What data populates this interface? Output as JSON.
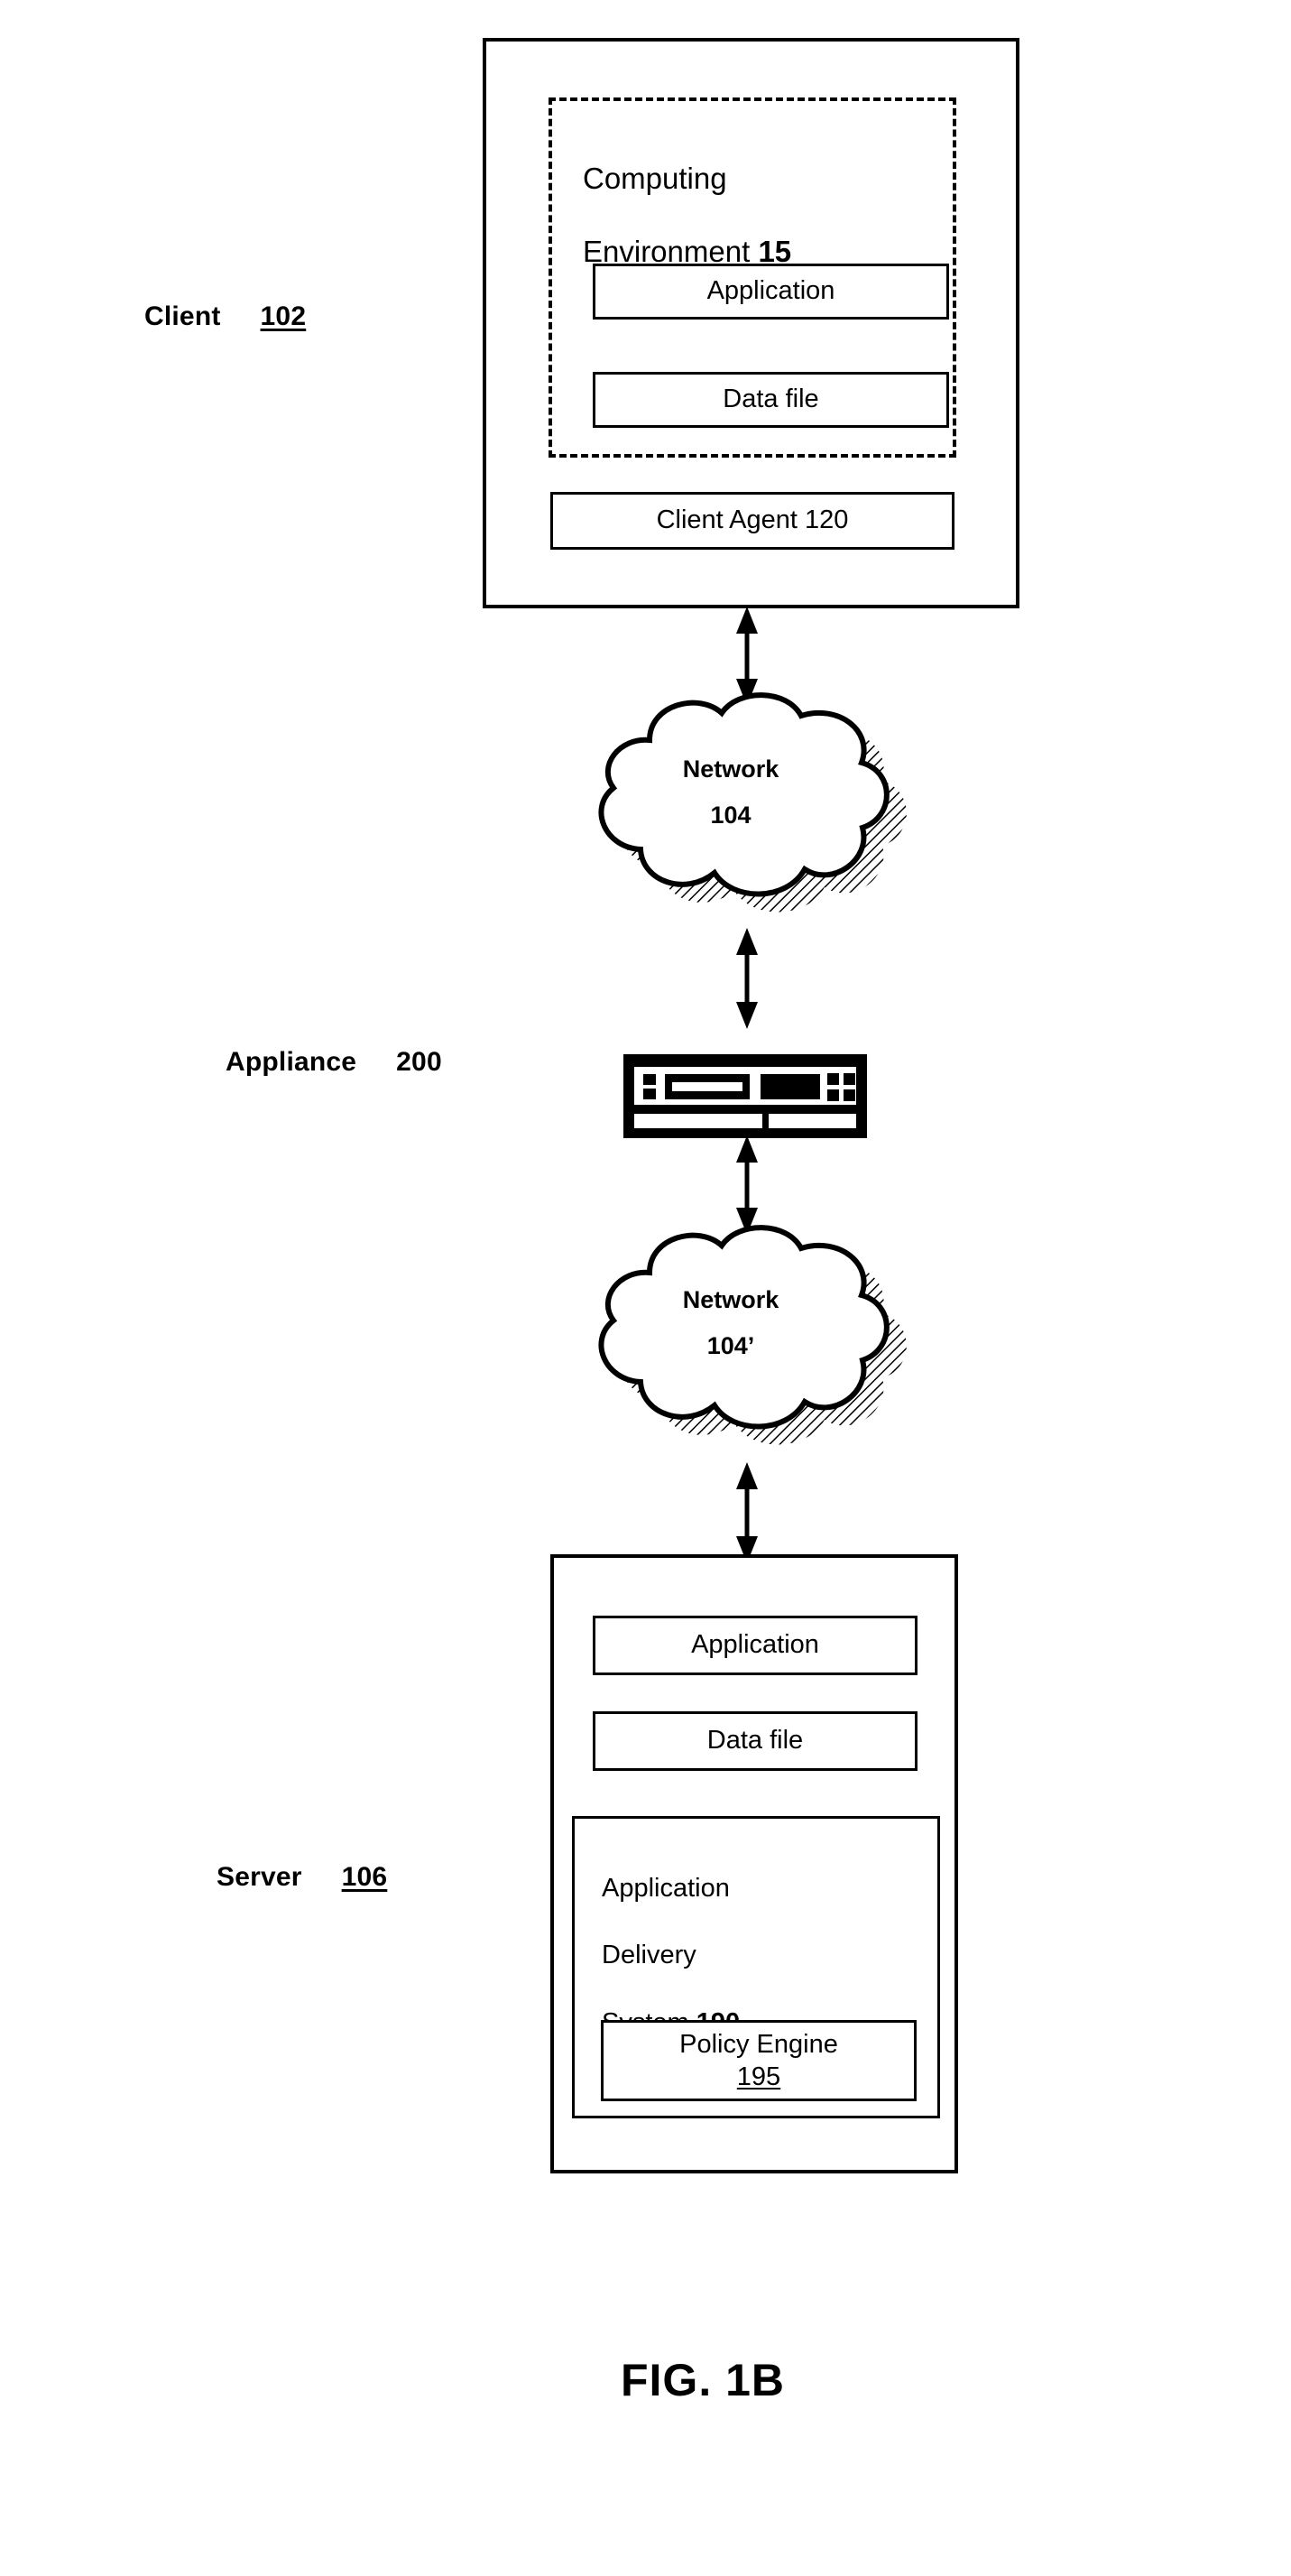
{
  "figure": {
    "caption": "FIG. 1B"
  },
  "client": {
    "label": "Client",
    "ref": "102",
    "computing_environment": {
      "title_line1": "Computing",
      "title_line2": "Environment ",
      "ref": "15"
    },
    "boxes": [
      {
        "label": "Application"
      },
      {
        "label": "Data file"
      }
    ],
    "client_agent": {
      "label": "Client Agent 120"
    }
  },
  "network_top": {
    "name": "Network",
    "ref": "104"
  },
  "appliance": {
    "label": "Appliance",
    "ref": "200",
    "icon": "rack-appliance-icon"
  },
  "network_bottom": {
    "name": "Network",
    "ref": "104’"
  },
  "server": {
    "label": "Server",
    "ref": "106",
    "boxes": [
      {
        "label": "Application"
      },
      {
        "label": "Data file"
      }
    ],
    "application_delivery_system": {
      "title_line1": "Application",
      "title_line2": "Delivery",
      "title_line3": "System ",
      "ref": "190",
      "policy_engine": {
        "label": "Policy Engine",
        "ref": "195"
      }
    }
  },
  "connectors": {
    "client_to_network": "bidirectional-arrow",
    "network_to_appliance": "bidirectional-arrow",
    "appliance_to_network2": "bidirectional-arrow",
    "network2_to_server": "bidirectional-arrow"
  },
  "colors": {
    "stroke": "#000000",
    "background": "#ffffff"
  }
}
